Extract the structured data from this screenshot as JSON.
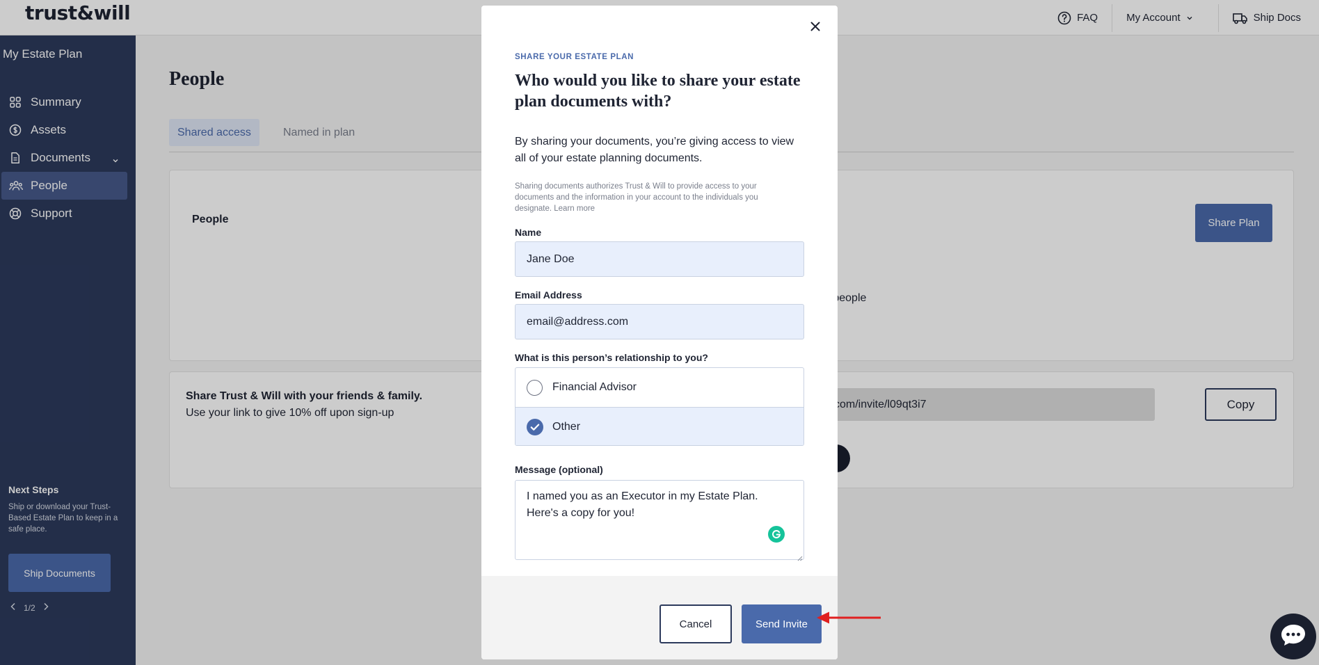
{
  "header": {
    "logo_text": "trust&will",
    "faq_label": "FAQ",
    "account_label": "My Account",
    "ship_docs_label": "Ship Docs"
  },
  "sidebar": {
    "title": "My Estate Plan",
    "items": [
      {
        "label": "Summary",
        "icon": "grid-icon"
      },
      {
        "label": "Assets",
        "icon": "dollar-circle-icon"
      },
      {
        "label": "Documents",
        "icon": "document-icon"
      },
      {
        "label": "People",
        "icon": "people-icon",
        "active": true
      },
      {
        "label": "Support",
        "icon": "lifebuoy-icon"
      }
    ],
    "next_steps": {
      "title": "Next Steps",
      "text": "Ship or download your Trust-Based Estate Plan to keep in a safe place.",
      "button_label": "Ship Documents",
      "pager": "1/2"
    }
  },
  "main": {
    "title": "People",
    "tabs": [
      {
        "label": "Shared access",
        "active": true
      },
      {
        "label": "Named in plan",
        "active": false
      }
    ],
    "people_card": {
      "title": "People",
      "share_button": "Share Plan",
      "partial_text": "e people"
    },
    "referral": {
      "title": "Share Trust & Will with your friends & family.",
      "subtitle": "Use your link to give 10% off upon sign-up",
      "link_visible": "l.com/invite/l09qt3i7",
      "copy_label": "Copy"
    }
  },
  "modal": {
    "eyebrow": "SHARE YOUR ESTATE PLAN",
    "title": "Who would you like to share your estate plan documents with?",
    "description": "By sharing your documents, you’re giving access to view all of your estate planning documents.",
    "fine_print": "Sharing documents authorizes Trust & Will to provide access to your documents and the information in your account to the individuals you designate. Learn more",
    "name_label": "Name",
    "name_value": "Jane Doe",
    "email_label": "Email Address",
    "email_value": "email@address.com",
    "relationship_label": "What is this person’s relationship to you?",
    "relationship_options": [
      {
        "label": "Financial Advisor",
        "selected": false
      },
      {
        "label": "Other",
        "selected": true
      }
    ],
    "message_label": "Message (optional)",
    "message_value": "I named you as an Executor in my Estate Plan. Here's a copy for you!",
    "cancel_label": "Cancel",
    "send_label": "Send Invite"
  },
  "colors": {
    "sidebar_bg": "#2c3a5c",
    "primary": "#4a6aab",
    "input_bg": "#e8effc",
    "annotation_arrow": "#e02020"
  }
}
